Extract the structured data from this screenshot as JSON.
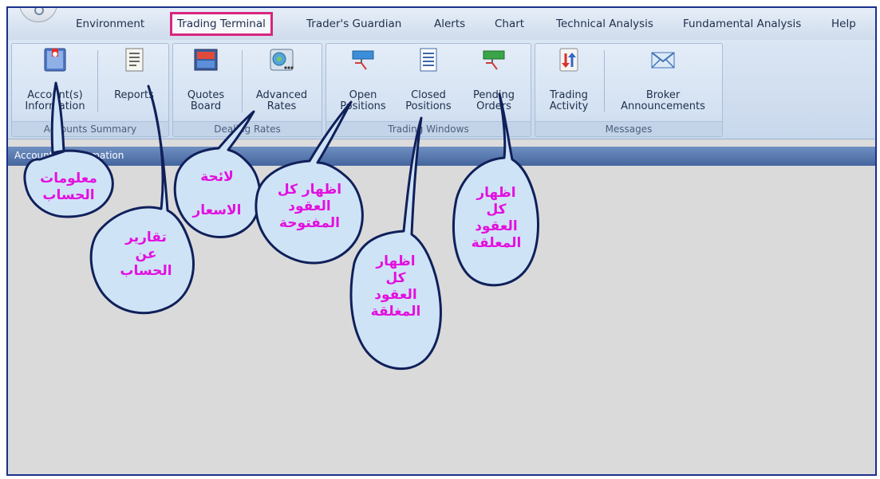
{
  "menu": {
    "environment": "Environment",
    "trading_terminal": "Trading Terminal",
    "traders_guardian": "Trader's Guardian",
    "alerts": "Alerts",
    "chart": "Chart",
    "technical_analysis": "Technical Analysis",
    "fundamental_analysis": "Fundamental Analysis",
    "help": "Help"
  },
  "ribbon": {
    "accounts_summary": {
      "label": "Accounts Summary",
      "account_information": "Account(s)\nInformation",
      "reports": "Reports"
    },
    "dealing_rates": {
      "label": "Dealing Rates",
      "quotes_board": "Quotes\nBoard",
      "advanced_rates": "Advanced\nRates"
    },
    "trading_windows": {
      "label": "Trading Windows",
      "open_positions": "Open\nPositions",
      "closed_positions": "Closed\nPositions",
      "pending_orders": "Pending\nOrders"
    },
    "messages": {
      "label": "Messages",
      "trading_activity": "Trading\nActivity",
      "broker_announcements": "Broker\nAnnouncements"
    }
  },
  "panel": {
    "title": "Account(s) Information"
  },
  "annotations": {
    "account_info": "معلومات\nالحساب",
    "reports": "تقارير\nعن\nالحساب",
    "rates_list": "لائحة\n\nالاسعار",
    "open_positions": "اظهار كل\nالعقود\nالمفتوحة",
    "closed_positions": "اظهار\nكل\nالعقود\nالمغلقة",
    "pending_orders": "اظهار\nكل\nالعقود\nالمعلقة"
  },
  "colors": {
    "frame": "#1c2f8c",
    "active_menu_border": "#d8267f",
    "annotation_text": "#e30fe0",
    "bubble_fill": "#cfe3f7",
    "bubble_stroke": "#10205a"
  }
}
